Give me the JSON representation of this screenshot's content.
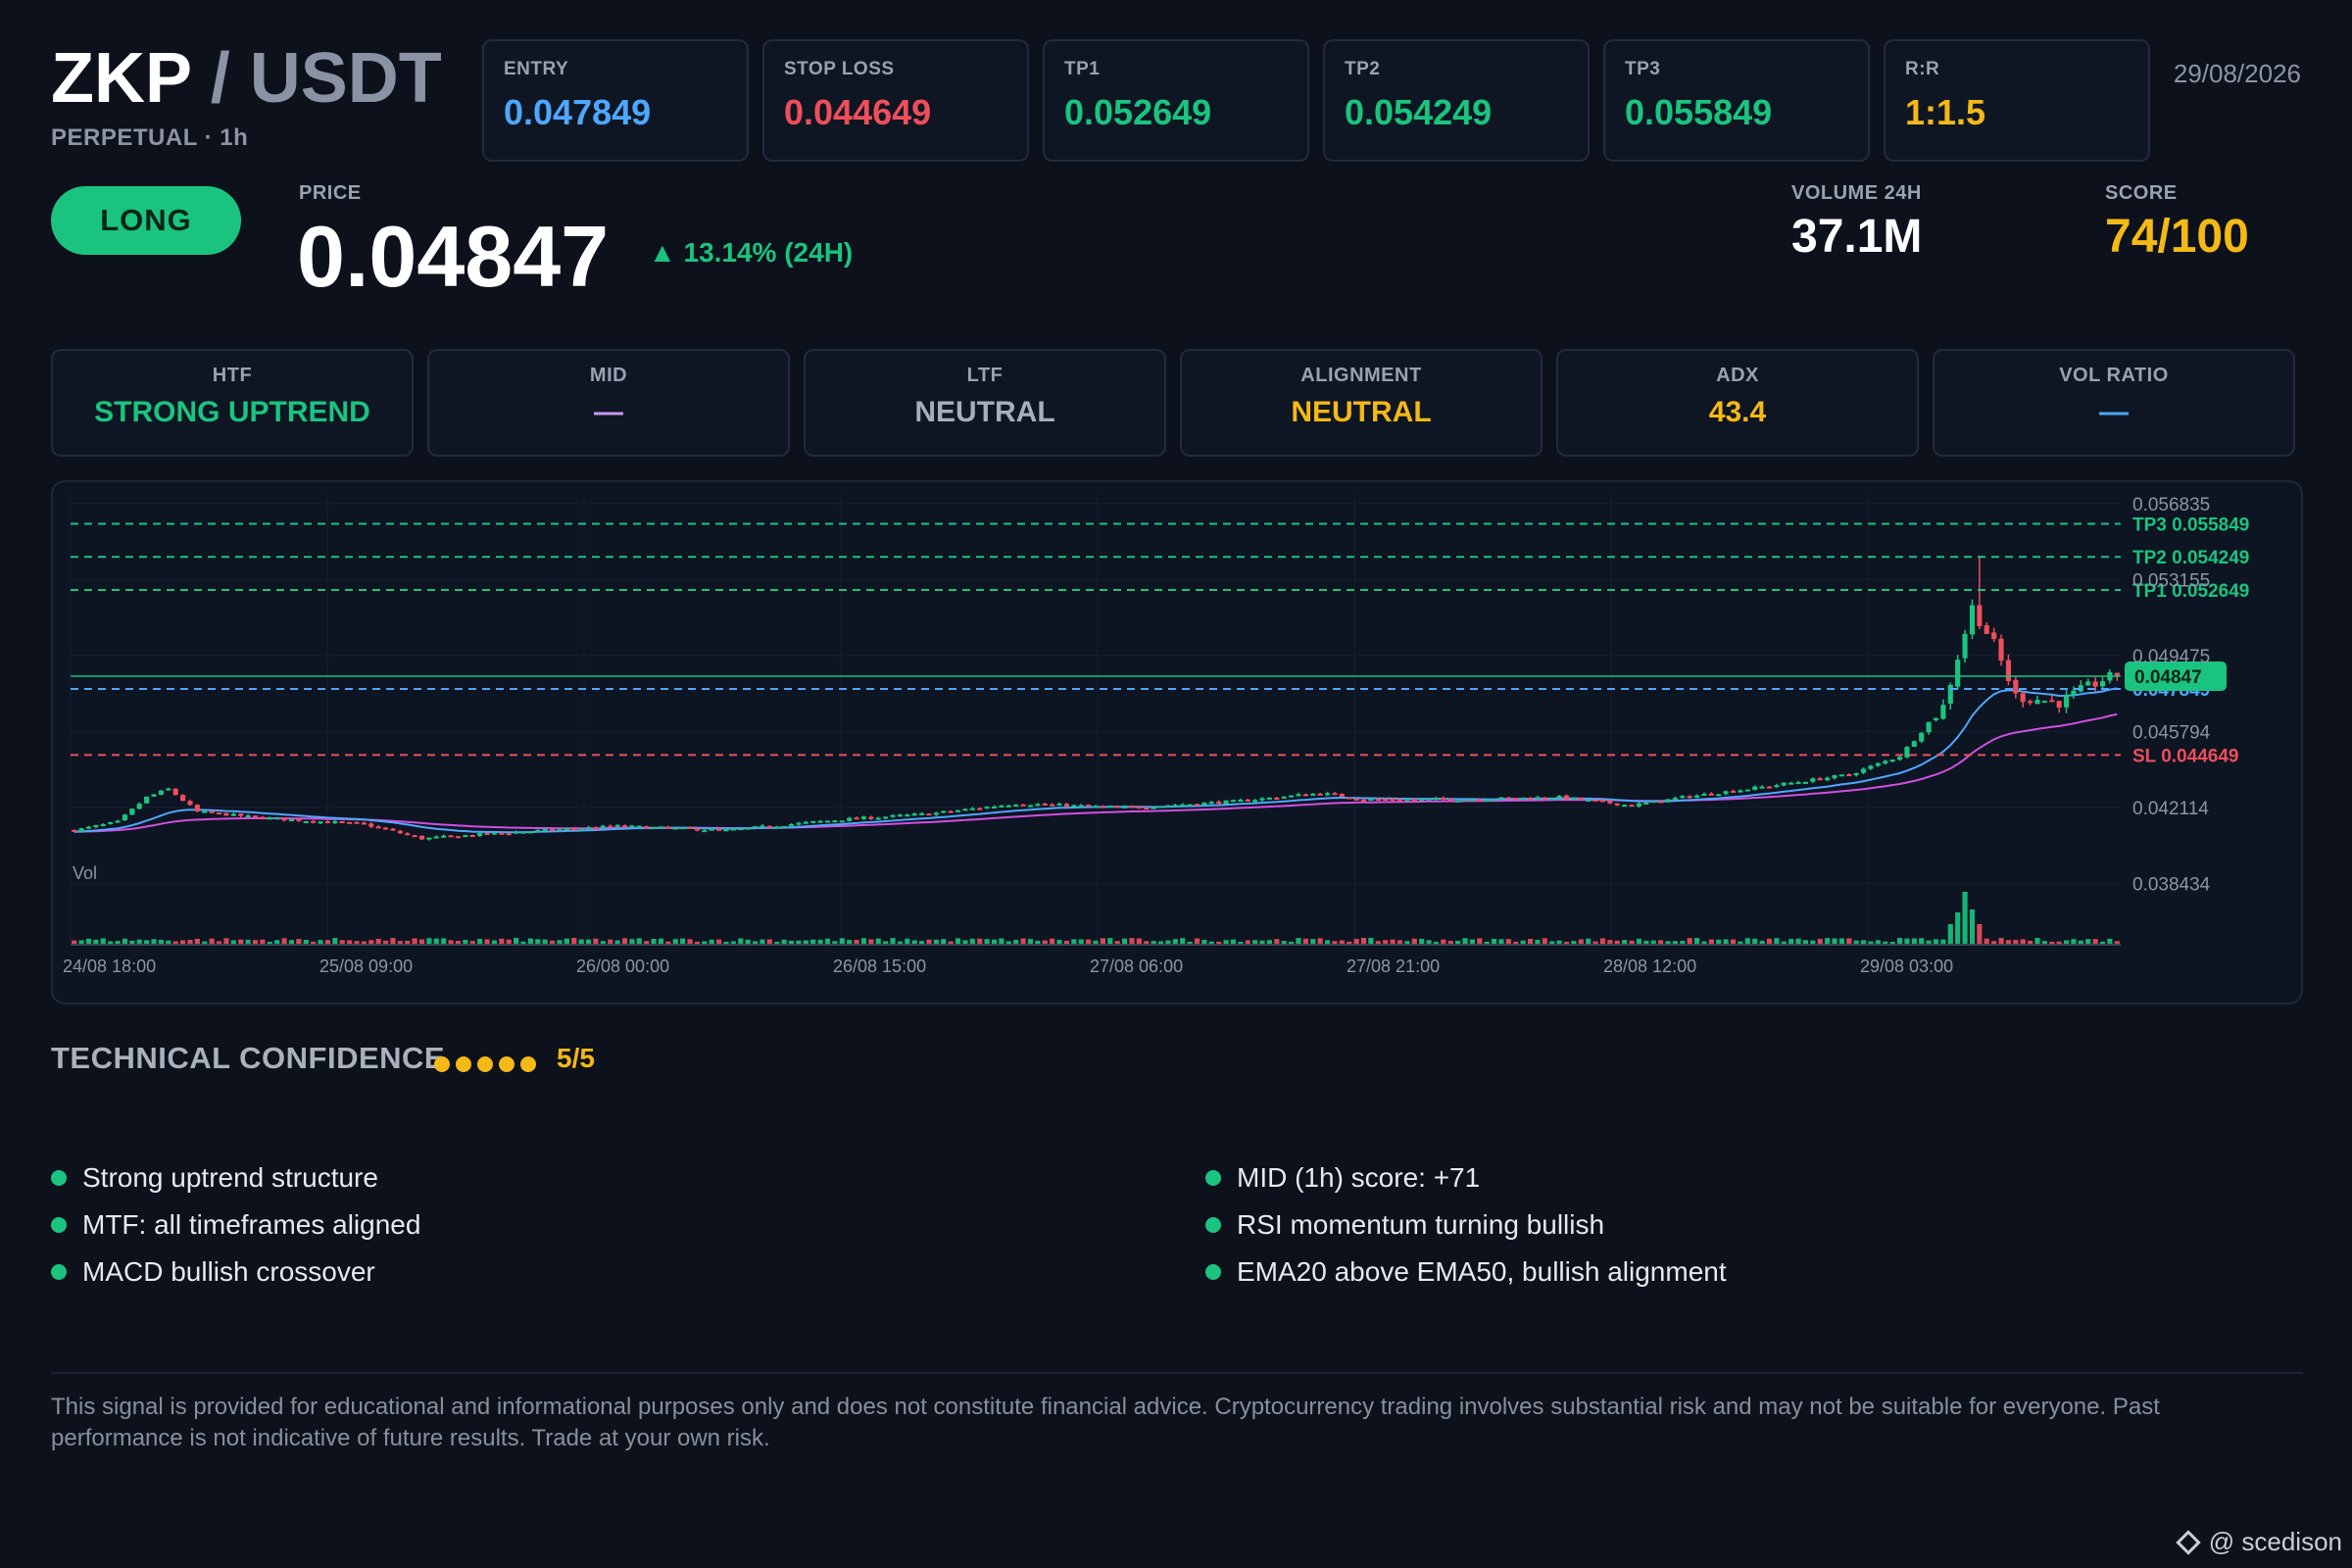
{
  "header": {
    "base": "ZKP",
    "sep": " / ",
    "quote": "USDT",
    "subtitle": "PERPETUAL · 1h",
    "date": "29/08/2026"
  },
  "levels": [
    {
      "label": "ENTRY",
      "value": "0.047849",
      "color": "#4ea7ff"
    },
    {
      "label": "STOP LOSS",
      "value": "0.044649",
      "color": "#ef4e5c"
    },
    {
      "label": "TP1",
      "value": "0.052649",
      "color": "#1ac47f"
    },
    {
      "label": "TP2",
      "value": "0.054249",
      "color": "#1ac47f"
    },
    {
      "label": "TP3",
      "value": "0.055849",
      "color": "#1ac47f"
    },
    {
      "label": "R:R",
      "value": "1:1.5",
      "color": "#f5b915"
    }
  ],
  "signal": {
    "side": "LONG",
    "price_label": "PRICE",
    "price": "0.04847",
    "change": "▲ 13.14% (24H)",
    "volume_label": "VOLUME 24H",
    "volume": "37.1M",
    "score_label": "SCORE",
    "score": "74/100"
  },
  "indicators": [
    {
      "label": "HTF",
      "value": "STRONG UPTREND",
      "color": "#1ac47f"
    },
    {
      "label": "MID",
      "value": "—",
      "color": "#c79bf2"
    },
    {
      "label": "LTF",
      "value": "NEUTRAL",
      "color": "#a7aebb"
    },
    {
      "label": "ALIGNMENT",
      "value": "NEUTRAL",
      "color": "#f5b915"
    },
    {
      "label": "ADX",
      "value": "43.4",
      "color": "#f5b915"
    },
    {
      "label": "VOL RATIO",
      "value": "—",
      "color": "#4ea7ff"
    }
  ],
  "chart_data": {
    "type": "candlestick",
    "pair": "ZKP/USDT",
    "interval": "1h",
    "x_ticks": [
      "24/08 18:00",
      "25/08 09:00",
      "26/08 00:00",
      "26/08 15:00",
      "27/08 06:00",
      "27/08 21:00",
      "28/08 12:00",
      "29/08 03:00"
    ],
    "y_ticks": [
      "0.056835",
      "0.053155",
      "0.049475",
      "0.045794",
      "0.042114",
      "0.038434"
    ],
    "ylim": [
      0.0365,
      0.0573
    ],
    "volume_label": "Vol",
    "level_lines": [
      {
        "label": "TP3 0.055849",
        "value": 0.055849,
        "color": "#1ac47f",
        "style": "dashed"
      },
      {
        "label": "TP2 0.054249",
        "value": 0.054249,
        "color": "#1ac47f",
        "style": "dashed"
      },
      {
        "label": "TP1 0.052649",
        "value": 0.052649,
        "color": "#1ac47f",
        "style": "dashed"
      },
      {
        "label": "0.047849",
        "value": 0.047849,
        "color": "#4ea7ff",
        "style": "dashed"
      },
      {
        "label": "SL 0.044649",
        "value": 0.044649,
        "color": "#ef4e5c",
        "style": "dashed"
      }
    ],
    "last_price": {
      "label": "0.04847",
      "value": 0.04847,
      "color": "#1ac47f"
    },
    "series": [
      {
        "name": "EMA20",
        "color": "#4ea7ff"
      },
      {
        "name": "EMA50",
        "color": "#d14fe0"
      }
    ],
    "anchors": [
      [
        0,
        0.041
      ],
      [
        6,
        0.0414
      ],
      [
        10,
        0.0426
      ],
      [
        13,
        0.043
      ],
      [
        17,
        0.0419
      ],
      [
        26,
        0.0416
      ],
      [
        40,
        0.0413
      ],
      [
        48,
        0.0406
      ],
      [
        60,
        0.0409
      ],
      [
        75,
        0.0412
      ],
      [
        90,
        0.041
      ],
      [
        105,
        0.0415
      ],
      [
        118,
        0.0418
      ],
      [
        130,
        0.0423
      ],
      [
        145,
        0.0421
      ],
      [
        160,
        0.0424
      ],
      [
        172,
        0.0428
      ],
      [
        178,
        0.0425
      ],
      [
        190,
        0.0425
      ],
      [
        205,
        0.0426
      ],
      [
        215,
        0.0422
      ],
      [
        222,
        0.0426
      ],
      [
        233,
        0.0431
      ],
      [
        245,
        0.0437
      ],
      [
        252,
        0.0446
      ],
      [
        258,
        0.047
      ],
      [
        262,
        0.0518
      ],
      [
        265,
        0.05
      ],
      [
        268,
        0.0475
      ],
      [
        274,
        0.0472
      ],
      [
        280,
        0.0483
      ],
      [
        282,
        0.04847
      ]
    ],
    "spike": {
      "index": 263,
      "high": 0.0543
    },
    "volume_spikes": [
      [
        259,
        0.35
      ],
      [
        260,
        0.55
      ],
      [
        261,
        0.9
      ],
      [
        262,
        0.6
      ],
      [
        263,
        0.35
      ]
    ]
  },
  "confidence": {
    "title": "TECHNICAL CONFIDENCE",
    "dots": 5,
    "score": "5/5"
  },
  "reasons_left": [
    "Strong uptrend structure",
    "MTF: all timeframes aligned",
    "MACD bullish crossover"
  ],
  "reasons_right": [
    "MID (1h) score: +71",
    "RSI momentum turning bullish",
    "EMA20 above EMA50, bullish alignment"
  ],
  "disclaimer": "This signal is provided for educational and informational purposes only and does not constitute financial advice. Cryptocurrency trading involves substantial risk and may not be suitable for everyone. Past performance is not indicative of future results. Trade at your own risk.",
  "watermark": "@ scedison"
}
